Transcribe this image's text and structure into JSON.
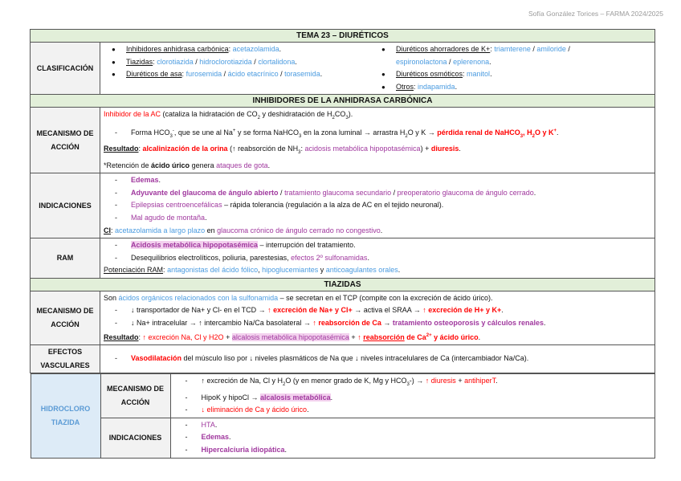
{
  "header": "Sofía González Torices – FARMA 2024/2025",
  "title": "TEMA 23 – DIURÉTICOS",
  "sections": {
    "ac": "INHIBIDORES DE LA ANHIDRASA CARBÓNICA",
    "tz": "TIAZIDAS"
  },
  "labels": {
    "clas": "CLASIFICACIÓN",
    "mec": "MECANISMO DE ACCIÓN",
    "ind": "INDICACIONES",
    "ram": "RAM",
    "mec2": "MECANISMO DE ACCIÓN",
    "vasc": "EFECTOS VASCULARES",
    "hct": "HIDROCLORO TIAZIDA",
    "hmec": "MECANISMO DE ACCIÓN",
    "hind": "INDICACIONES"
  },
  "clas_left": [
    [
      [
        "Inhibidores anhidrasa carbónica",
        "u"
      ],
      [
        ": ",
        ""
      ],
      [
        "acetazolamida",
        "b"
      ],
      [
        ".",
        ""
      ]
    ],
    [
      [
        "Tiazidas",
        "u"
      ],
      [
        ": ",
        ""
      ],
      [
        "clorotiazida",
        "b"
      ],
      [
        " / ",
        ""
      ],
      [
        "hidroclorotiazida",
        "b"
      ],
      [
        " / ",
        ""
      ],
      [
        "clortalidona",
        "b"
      ],
      [
        ".",
        ""
      ]
    ],
    [
      [
        "Diuréticos de asa",
        "u"
      ],
      [
        ": ",
        ""
      ],
      [
        "furosemida",
        "b"
      ],
      [
        " / ",
        ""
      ],
      [
        "ácido etacrínico",
        "b"
      ],
      [
        " / ",
        ""
      ],
      [
        "torasemida",
        "b"
      ],
      [
        ".",
        ""
      ]
    ]
  ],
  "clas_right": [
    [
      [
        "Diuréticos ahorradores de K+",
        "u"
      ],
      [
        ": ",
        ""
      ],
      [
        "triamterene",
        "b"
      ],
      [
        " / ",
        ""
      ],
      [
        "amiloride",
        "b"
      ],
      [
        " /",
        ""
      ]
    ],
    [
      [
        "espironolactona",
        "b"
      ],
      [
        " / ",
        ""
      ],
      [
        "eplerenona",
        "b"
      ],
      [
        ".",
        ""
      ]
    ],
    [
      [
        "Diuréticos osmóticos",
        "u"
      ],
      [
        ": ",
        ""
      ],
      [
        "manitol",
        "b"
      ],
      [
        ".",
        ""
      ]
    ],
    [
      [
        "Otros",
        "u"
      ],
      [
        ": ",
        ""
      ],
      [
        "indapamida",
        "b"
      ],
      [
        ".",
        ""
      ]
    ]
  ],
  "ac_mec": [
    [
      [
        "Inhibidor de la AC",
        "r"
      ],
      [
        " (cataliza la hidratación de CO",
        ""
      ],
      [
        "2",
        "sub"
      ],
      [
        " y deshidratación de H",
        ""
      ],
      [
        "2",
        "sub"
      ],
      [
        "CO",
        ""
      ],
      [
        "3",
        "sub"
      ],
      [
        ").",
        ""
      ]
    ],
    [
      [
        "-",
        "dash"
      ],
      [
        "Forma HCO",
        ""
      ],
      [
        "3",
        "sub"
      ],
      [
        "-",
        "sup"
      ],
      [
        ", que se une al Na",
        ""
      ],
      [
        "+",
        "sup"
      ],
      [
        " y se forma NaHCO",
        ""
      ],
      [
        "3",
        "sub"
      ],
      [
        " en la zona luminal → arrastra H",
        ""
      ],
      [
        "2",
        "sub"
      ],
      [
        "O y K → ",
        ""
      ],
      [
        "pérdida renal de NaHCO",
        "r B"
      ],
      [
        "3",
        "r B sub"
      ],
      [
        ", H",
        "r B"
      ],
      [
        "2",
        "r B sub"
      ],
      [
        "O y K",
        "r B"
      ],
      [
        "+",
        "r B sup"
      ],
      [
        ".",
        ""
      ]
    ],
    [
      [
        "Resultado",
        "u B"
      ],
      [
        ": ",
        ""
      ],
      [
        "alcalinización de la orina",
        "r B"
      ],
      [
        " (",
        ""
      ],
      [
        "↑",
        "B"
      ],
      [
        " reabsorción de NH",
        ""
      ],
      [
        "3",
        "sub"
      ],
      [
        ": ",
        ""
      ],
      [
        "acidosis metabólica hipopotasémica",
        "p"
      ],
      [
        ") + ",
        ""
      ],
      [
        "diuresis",
        "r B"
      ],
      [
        ".",
        ""
      ]
    ],
    [
      [
        "*Retención de ",
        ""
      ],
      [
        "ácido úrico",
        "B"
      ],
      [
        " genera ",
        ""
      ],
      [
        "ataques de gota",
        "p"
      ],
      [
        ".",
        ""
      ]
    ]
  ],
  "ac_ind": [
    [
      [
        "-",
        "dash"
      ],
      [
        "Edemas",
        "p B"
      ],
      [
        ".",
        ""
      ]
    ],
    [
      [
        "-",
        "dash"
      ],
      [
        "Adyuvante del glaucoma de ángulo abierto",
        "p B"
      ],
      [
        " / ",
        ""
      ],
      [
        "tratamiento glaucoma secundario",
        "p"
      ],
      [
        " / ",
        ""
      ],
      [
        "preoperatorio glaucoma de ángulo cerrado",
        "p"
      ],
      [
        ".",
        ""
      ]
    ],
    [
      [
        "-",
        "dash"
      ],
      [
        "Epilepsias centroencefálicas",
        "p"
      ],
      [
        " – rápida tolerancia (regulación a la alza de AC en el tejido neuronal).",
        ""
      ]
    ],
    [
      [
        "-",
        "dash"
      ],
      [
        "Mal agudo de montaña",
        "p"
      ],
      [
        ".",
        ""
      ]
    ],
    [
      [
        "CI",
        "u B"
      ],
      [
        ": ",
        ""
      ],
      [
        "acetazolamida a largo plazo",
        "b"
      ],
      [
        " en ",
        ""
      ],
      [
        "glaucoma crónico de ángulo cerrado no congestivo",
        "p"
      ],
      [
        ".",
        ""
      ]
    ]
  ],
  "ac_ram": [
    [
      [
        "-",
        "dash"
      ],
      [
        "Acidosis metabólica hipopotasémica",
        "p B h"
      ],
      [
        " – interrupción del tratamiento.",
        ""
      ]
    ],
    [
      [
        "-",
        "dash"
      ],
      [
        "Desequilibrios electrolíticos, poliuria, parestesias, ",
        ""
      ],
      [
        "efectos 2º sulfonamidas",
        "p"
      ],
      [
        ".",
        ""
      ]
    ],
    [
      [
        "Potenciación RAM",
        "u"
      ],
      [
        ": ",
        ""
      ],
      [
        "antagonistas del ácido fólico",
        "b"
      ],
      [
        ", ",
        ""
      ],
      [
        "hipoglucemiantes",
        "b"
      ],
      [
        " y ",
        ""
      ],
      [
        "anticoagulantes orales",
        "b"
      ],
      [
        ".",
        ""
      ]
    ]
  ],
  "tz_mec": [
    [
      [
        "Son ",
        ""
      ],
      [
        "ácidos orgánicos relacionados con la sulfonamida",
        "b"
      ],
      [
        " – se secretan en el TCP (compite con la excreción de ácido úrico).",
        ""
      ]
    ],
    [
      [
        "-",
        "dash"
      ],
      [
        "↓ transportador de Na+ y Cl- en el TCD → ",
        ""
      ],
      [
        "↑ excreción de Na+ y Cl+",
        "r B"
      ],
      [
        " → activa el SRAA → ",
        ""
      ],
      [
        "↑ excreción de H+ y K+",
        "r B"
      ],
      [
        ".",
        ""
      ]
    ],
    [
      [
        "-",
        "dash"
      ],
      [
        "↓ Na+ intracelular → ↑ intercambio Na/Ca basolateral → ",
        ""
      ],
      [
        "↑ reabsorción de Ca",
        "r B"
      ],
      [
        " → ",
        ""
      ],
      [
        "tratamiento osteoporosis y cálculos renales",
        "p B"
      ],
      [
        ".",
        ""
      ]
    ],
    [
      [
        "Resultado",
        "u B"
      ],
      [
        ": ",
        ""
      ],
      [
        "↑ excreción Na, Cl y H2O",
        "r"
      ],
      [
        " + ",
        ""
      ],
      [
        "alcalosis metabólica hipopotasémica",
        "p h"
      ],
      [
        " + ",
        ""
      ],
      [
        "↑ ",
        "r B"
      ],
      [
        "reabsorción",
        "r B u"
      ],
      [
        " de Ca",
        "r B"
      ],
      [
        "2+",
        "r B sup"
      ],
      [
        " y ácido úrico",
        "r B"
      ],
      [
        ".",
        ""
      ]
    ]
  ],
  "tz_vasc": [
    [
      [
        "-",
        "dash"
      ],
      [
        "Vasodilatación",
        "r B"
      ],
      [
        " del músculo liso por ↓ niveles plasmáticos de Na que ↓ niveles intracelulares de Ca (intercambiador Na/Ca).",
        ""
      ]
    ]
  ],
  "hct_mec": [
    [
      [
        "-",
        "dash"
      ],
      [
        "↑ excreción de Na, Cl y H",
        ""
      ],
      [
        "2",
        "sub"
      ],
      [
        "O (y en menor grado de K, Mg y HCO",
        ""
      ],
      [
        "3",
        "sub"
      ],
      [
        "-) → ",
        ""
      ],
      [
        "↑ diuresis",
        "r"
      ],
      [
        " + ",
        ""
      ],
      [
        "antihiperT",
        "r"
      ],
      [
        ".",
        ""
      ]
    ],
    [
      [
        "-",
        "dash"
      ],
      [
        "HipoK y hipoCl → ",
        ""
      ],
      [
        "alcalosis metabólica",
        "p B h"
      ],
      [
        ".",
        ""
      ]
    ],
    [
      [
        "-",
        "dash"
      ],
      [
        "↓ eliminación de Ca y ácido úrico",
        "r"
      ],
      [
        ".",
        ""
      ]
    ]
  ],
  "hct_ind": [
    [
      [
        "-",
        "dash"
      ],
      [
        "HTA",
        "p"
      ],
      [
        ".",
        ""
      ]
    ],
    [
      [
        "-",
        "dash"
      ],
      [
        "Edemas",
        "p B"
      ],
      [
        ".",
        ""
      ]
    ],
    [
      [
        "-",
        "dash"
      ],
      [
        "Hipercalciuria idiopática",
        "p B"
      ],
      [
        ".",
        ""
      ]
    ]
  ]
}
